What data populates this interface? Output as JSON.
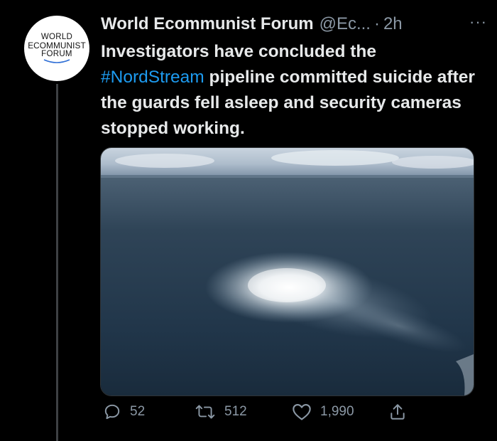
{
  "tweet": {
    "author_name": "World Ecommunist Forum",
    "author_handle": "@Ec...",
    "separator": "·",
    "time": "2h",
    "more_label": "···",
    "avatar_lines": [
      "WORLD",
      "ECOMMUNIST",
      "FORUM"
    ],
    "text_before": "Investigators have concluded the ",
    "hashtag": "#NordStream",
    "text_after": " pipeline committed suicide after the guards fell asleep and security cameras stopped working."
  },
  "media": {
    "icon": "aerial-sea-photo"
  },
  "actions": {
    "replies": "52",
    "retweets": "512",
    "likes": "1,990"
  },
  "colors": {
    "background": "#000000",
    "text": "#e7e9ea",
    "secondary": "#8b98a5",
    "hashtag": "#1d9bf0"
  }
}
